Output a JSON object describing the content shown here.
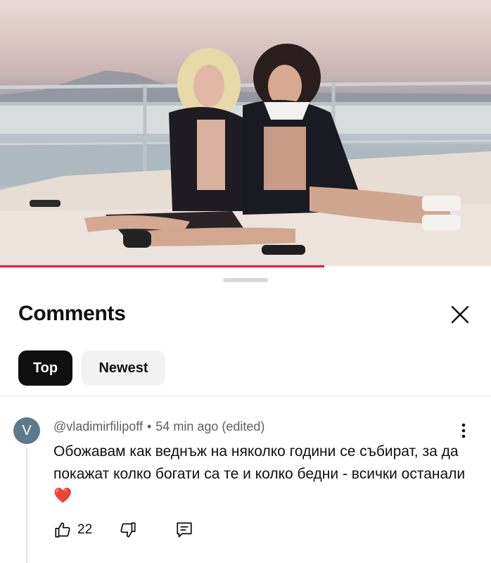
{
  "video": {
    "progress_fraction": 0.66
  },
  "comments_panel": {
    "title": "Comments",
    "close_icon": "close-icon",
    "sort_tabs": [
      {
        "label": "Top",
        "selected": true
      },
      {
        "label": "Newest",
        "selected": false
      }
    ]
  },
  "comment": {
    "avatar_letter": "V",
    "avatar_color": "#5c7a8c",
    "author": "@vladimirfilipoff",
    "separator": "•",
    "time": "54 min ago",
    "edited": "(edited)",
    "text": "Обожавам как веднъж на няколко години се събират, за да покажат колко богати са те и колко бедни - всички останали❤️",
    "like_count": "22",
    "icons": [
      "thumbs-up-icon",
      "thumbs-down-icon",
      "reply-icon",
      "more-vertical-icon"
    ]
  },
  "colors": {
    "progress_red": "#ff0033",
    "chip_selected_bg": "#0f0f0f",
    "chip_bg": "#f2f2f2",
    "meta_text": "#606060"
  }
}
